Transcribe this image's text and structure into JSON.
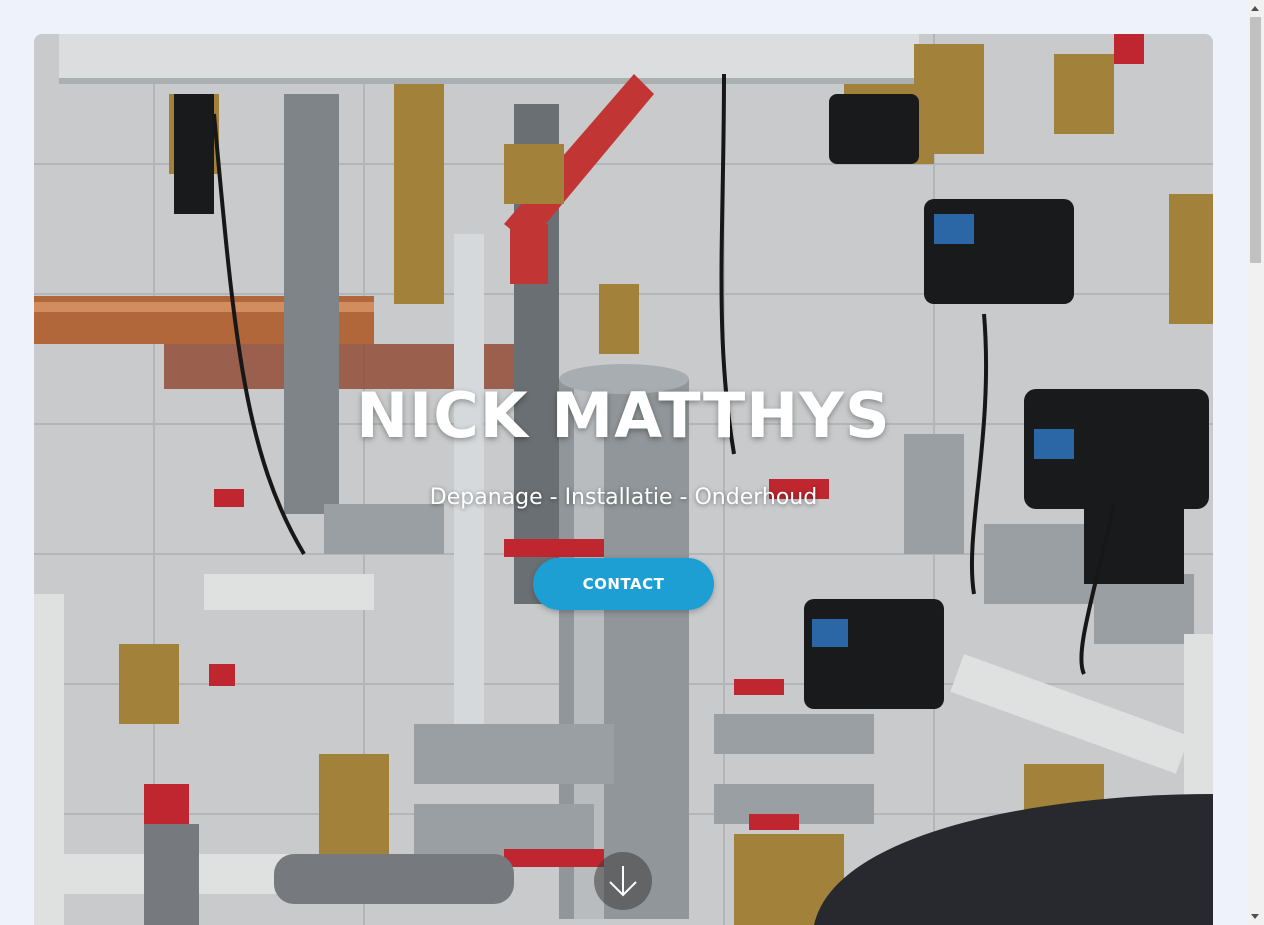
{
  "hero": {
    "title": "NICK MATTHYS",
    "subtitle": "Depanage - Installatie - Onderhoud",
    "contact_label": "CONTACT",
    "scroll_icon": "arrow-down-icon",
    "background_image": "boiler-room-pipes-photo"
  },
  "colors": {
    "accent": "#1e9fd3",
    "page_background": "#eef2fb"
  }
}
